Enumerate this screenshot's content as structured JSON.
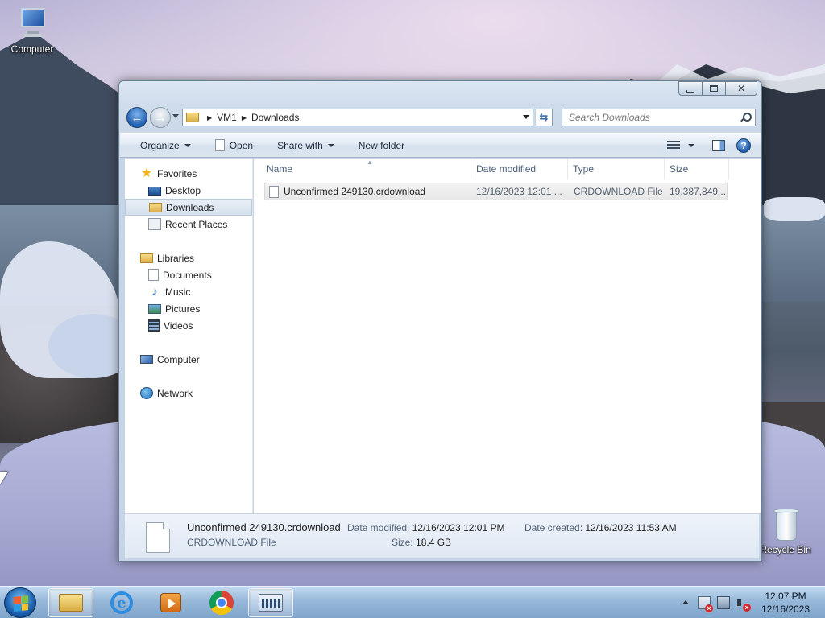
{
  "desktop": {
    "icons": {
      "computer": "Computer",
      "recycle_bin": "Recycle Bin"
    }
  },
  "window": {
    "address": {
      "segments": [
        "VM1",
        "Downloads"
      ]
    },
    "search": {
      "placeholder": "Search Downloads"
    },
    "caption_buttons": [
      "minimize",
      "restore",
      "close"
    ],
    "toolbar": {
      "organize": "Organize",
      "open": "Open",
      "share_with": "Share with",
      "new_folder": "New folder"
    },
    "nav_pane": {
      "favorites": "Favorites",
      "desktop": "Desktop",
      "downloads": "Downloads",
      "recent_places": "Recent Places",
      "libraries": "Libraries",
      "documents": "Documents",
      "music": "Music",
      "pictures": "Pictures",
      "videos": "Videos",
      "computer": "Computer",
      "network": "Network",
      "selected": "Downloads"
    },
    "file_list": {
      "columns": [
        "Name",
        "Date modified",
        "Type",
        "Size"
      ],
      "rows": [
        {
          "name": "Unconfirmed 249130.crdownload",
          "date_modified": "12/16/2023 12:01 ...",
          "type": "CRDOWNLOAD File",
          "size": "19,387,849 ..."
        }
      ]
    },
    "details": {
      "name": "Unconfirmed 249130.crdownload",
      "type": "CRDOWNLOAD File",
      "date_modified_label": "Date modified:",
      "date_modified": "12/16/2023 12:01 PM",
      "size_label": "Size:",
      "size": "18.4 GB",
      "date_created_label": "Date created:",
      "date_created": "12/16/2023 11:53 AM"
    }
  },
  "taskbar": {
    "pinned": [
      "windows-explorer-icon",
      "internet-explorer-icon",
      "media-player-icon",
      "chrome-icon",
      "on-screen-keyboard-icon"
    ],
    "clock": {
      "time": "12:07 PM",
      "date": "12/16/2023"
    }
  },
  "colors": {
    "window_frame": "#c5d4e6",
    "selection": "#d6e1ee",
    "accent": "#1f5fb0"
  }
}
